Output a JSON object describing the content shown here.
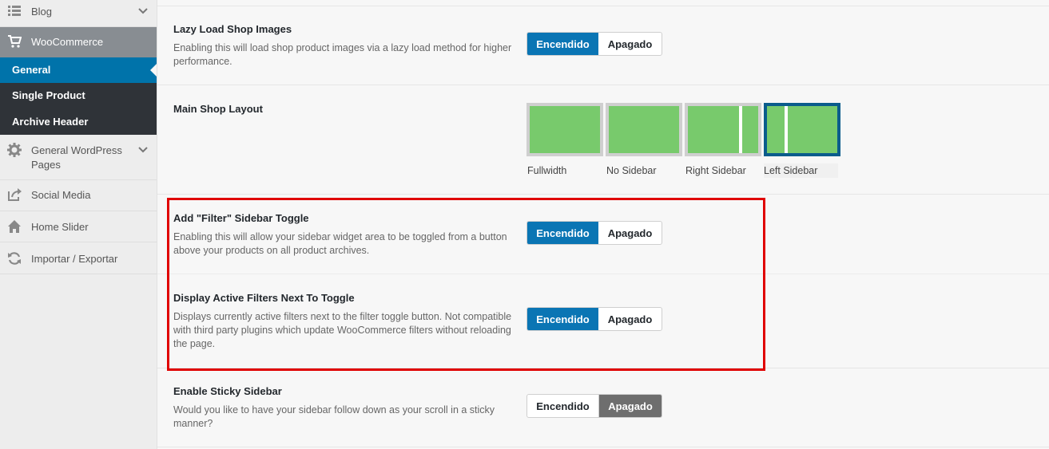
{
  "sidebar": {
    "blog": "Blog",
    "woocommerce": "WooCommerce",
    "submenu": [
      "General",
      "Single Product",
      "Archive Header"
    ],
    "general_wp_pages": "General WordPress Pages",
    "social_media": "Social Media",
    "home_slider": "Home Slider",
    "import_export": "Importar / Exportar"
  },
  "settings": {
    "lazy_load": {
      "title": "Lazy Load Shop Images",
      "desc": "Enabling this will load shop product images via a lazy load method for higher performance.",
      "on_label": "Encendido",
      "off_label": "Apagado",
      "state": "on"
    },
    "layout": {
      "title": "Main Shop Layout",
      "options": [
        "Fullwidth",
        "No Sidebar",
        "Right Sidebar",
        "Left Sidebar"
      ],
      "selected": "Left Sidebar"
    },
    "filter_toggle": {
      "title": "Add \"Filter\" Sidebar Toggle",
      "desc": "Enabling this will allow your sidebar widget area to be toggled from a button above your products on all product archives.",
      "on_label": "Encendido",
      "off_label": "Apagado",
      "state": "on"
    },
    "active_filters": {
      "title": "Display Active Filters Next To Toggle",
      "desc": "Displays currently active filters next to the filter toggle button. Not compatible with third party plugins which update WooCommerce filters without reloading the page.",
      "on_label": "Encendido",
      "off_label": "Apagado",
      "state": "on"
    },
    "sticky_sidebar": {
      "title": "Enable Sticky Sidebar",
      "desc": "Would you like to have your sidebar follow down as your scroll in a sticky manner?",
      "on_label": "Encendido",
      "off_label": "Apagado",
      "state": "off"
    }
  },
  "colors": {
    "accent": "#0a75b4",
    "highlight": "#e00000",
    "layout_green": "#78ca6c"
  }
}
